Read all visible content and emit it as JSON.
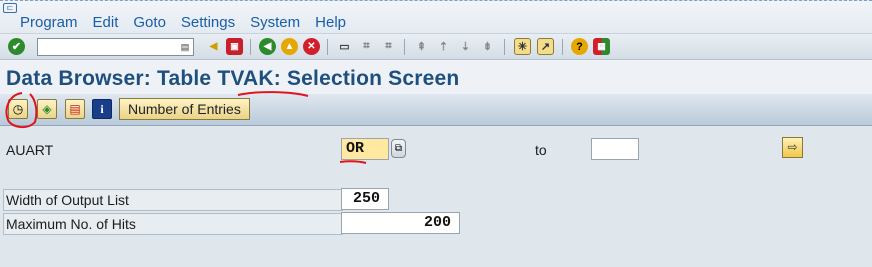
{
  "menubar": {
    "items": [
      "Program",
      "Edit",
      "Goto",
      "Settings",
      "System",
      "Help"
    ]
  },
  "toolbar": {
    "command_field_value": "",
    "icons": [
      "enter-icon",
      "back-icon",
      "exit-icon",
      "cancel-icon",
      "print-icon",
      "find-icon",
      "find-next-icon",
      "first-page-icon",
      "previous-page-icon",
      "next-page-icon",
      "last-page-icon",
      "create-session-icon",
      "create-shortcut-icon",
      "help-icon",
      "layout-icon"
    ]
  },
  "title": "Data Browser: Table TVAK: Selection Screen",
  "app_toolbar": {
    "number_of_entries_label": "Number of Entries",
    "icons": [
      "execute-icon",
      "execute-in-background-icon",
      "save-as-variant-icon",
      "info-icon"
    ]
  },
  "selection": {
    "auart_label": "AUART",
    "auart_value": "OR",
    "to_label": "to",
    "to_value": "",
    "width_label": "Width of Output List",
    "width_value": "250",
    "max_hits_label": "Maximum No. of Hits",
    "max_hits_value": "200"
  },
  "colors": {
    "title": "#1f4f7f",
    "menu_text": "#1a5ea8",
    "annotation_red": "#e0141e",
    "highlight_field": "#ffe9a0"
  }
}
